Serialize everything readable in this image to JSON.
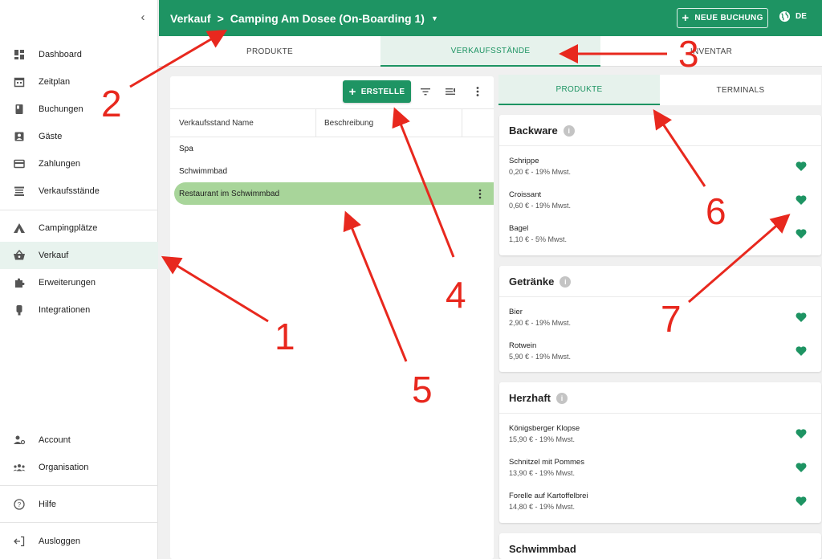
{
  "sidebar": {
    "collapse_glyph": "‹",
    "items": [
      {
        "label": "Dashboard",
        "icon": "dashboard-icon"
      },
      {
        "label": "Zeitplan",
        "icon": "calendar-icon"
      },
      {
        "label": "Buchungen",
        "icon": "book-icon"
      },
      {
        "label": "Gäste",
        "icon": "guest-icon"
      },
      {
        "label": "Zahlungen",
        "icon": "credit-card-icon"
      },
      {
        "label": "Verkaufsstände",
        "icon": "stand-icon"
      },
      {
        "label": "Campingplätze",
        "icon": "tent-icon"
      },
      {
        "label": "Verkauf",
        "icon": "basket-icon",
        "active": true
      },
      {
        "label": "Erweiterungen",
        "icon": "puzzle-icon"
      },
      {
        "label": "Integrationen",
        "icon": "plug-icon"
      },
      {
        "label": "Account",
        "icon": "account-icon"
      },
      {
        "label": "Organisation",
        "icon": "group-icon"
      },
      {
        "label": "Hilfe",
        "icon": "help-icon"
      },
      {
        "label": "Ausloggen",
        "icon": "logout-icon"
      }
    ]
  },
  "header": {
    "crumb_root": "Verkauf",
    "crumb_sep": ">",
    "crumb_current": "Camping Am Dosee (On-Boarding 1)",
    "new_booking_label": "NEUE BUCHUNG",
    "language": "DE"
  },
  "top_tabs": [
    {
      "label": "PRODUKTE"
    },
    {
      "label": "VERKAUFSSTÄNDE",
      "active": true
    },
    {
      "label": "INVENTAR"
    }
  ],
  "table": {
    "create_label": "ERSTELLE",
    "columns": [
      "Verkaufsstand Name",
      "Beschreibung"
    ],
    "rows": [
      {
        "name": "Spa"
      },
      {
        "name": "Schwimmbad"
      },
      {
        "name": "Restaurant im Schwimmbad",
        "selected": true
      }
    ]
  },
  "right_tabs": [
    {
      "label": "PRODUKTE",
      "active": true
    },
    {
      "label": "TERMINALS"
    }
  ],
  "categories": [
    {
      "title": "Backware",
      "products": [
        {
          "name": "Schrippe",
          "price": "0,20 € - 19% Mwst."
        },
        {
          "name": "Croissant",
          "price": "0,60 € - 19% Mwst."
        },
        {
          "name": "Bagel",
          "price": "1,10 € - 5% Mwst."
        }
      ]
    },
    {
      "title": "Getränke",
      "products": [
        {
          "name": "Bier",
          "price": "2,90 € - 19% Mwst."
        },
        {
          "name": "Rotwein",
          "price": "5,90 € - 19% Mwst."
        }
      ]
    },
    {
      "title": "Herzhaft",
      "products": [
        {
          "name": "Königsberger Klopse",
          "price": "15,90 € - 19% Mwst."
        },
        {
          "name": "Schnitzel mit Pommes",
          "price": "13,90 € - 19% Mwst."
        },
        {
          "name": "Forelle auf Kartoffelbrei",
          "price": "14,80 € - 19% Mwst."
        }
      ]
    },
    {
      "title": "Schwimmbad",
      "products": []
    }
  ],
  "annotations": [
    "1",
    "2",
    "3",
    "4",
    "5",
    "6",
    "7"
  ],
  "colors": {
    "brand": "#1e9463",
    "selected_row": "#a8d59a",
    "annotation": "#e8281e"
  }
}
